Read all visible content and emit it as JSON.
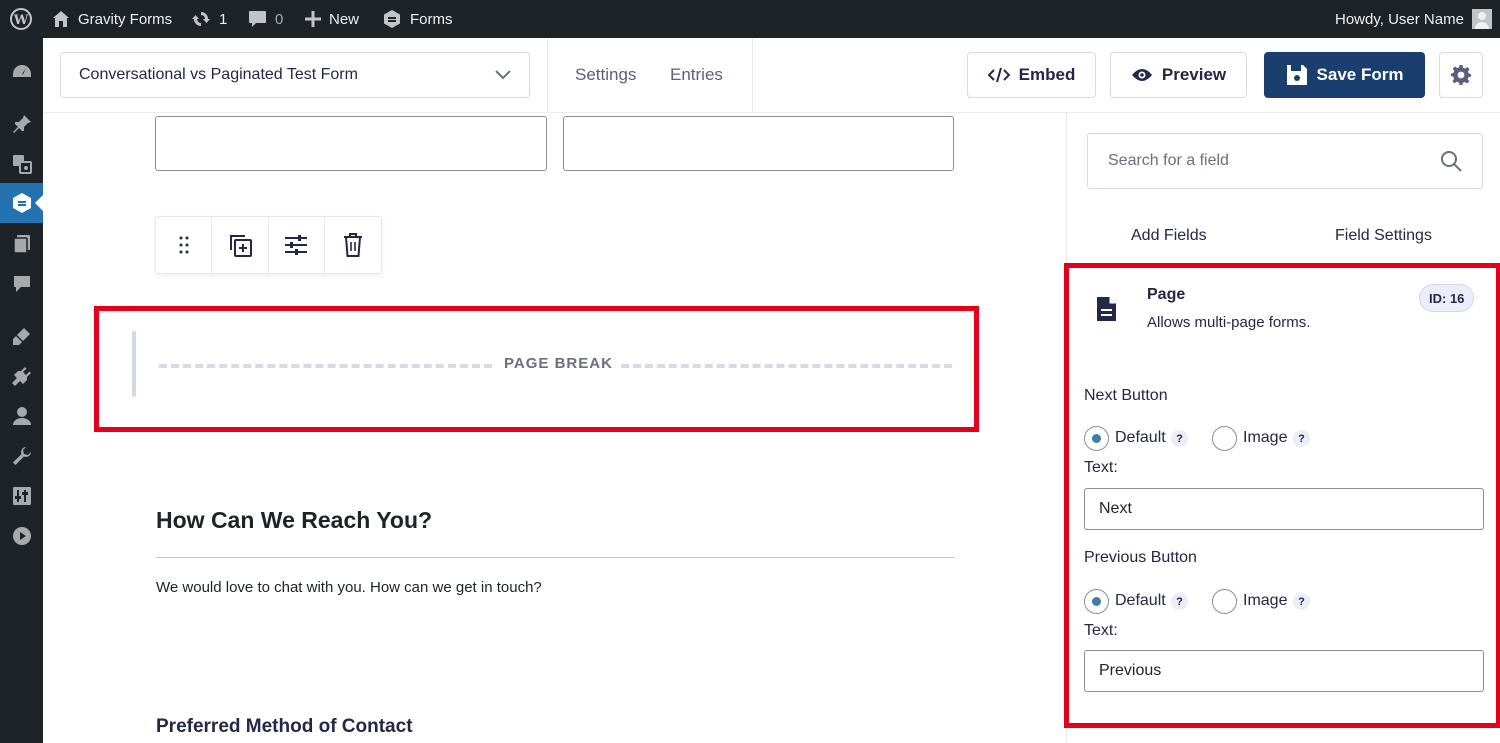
{
  "adminbar": {
    "site_name": "Gravity Forms",
    "updates_count": "1",
    "comments_count": "0",
    "new_label": "New",
    "forms_label": "Forms",
    "howdy": "Howdy, User Name"
  },
  "toolbar": {
    "form_title": "Conversational vs Paginated Test Form",
    "settings_label": "Settings",
    "entries_label": "Entries",
    "embed_label": "Embed",
    "preview_label": "Preview",
    "save_label": "Save Form"
  },
  "canvas": {
    "page_break_label": "PAGE BREAK",
    "section_title": "How Can We Reach You?",
    "section_description": "We would love to chat with you. How can we get in touch?",
    "next_field_label": "Preferred Method of Contact"
  },
  "sidebar": {
    "search_placeholder": "Search for a field",
    "tabs": [
      "Add Fields",
      "Field Settings"
    ],
    "field": {
      "name": "Page",
      "description": "Allows multi-page forms.",
      "id_badge": "ID: 16"
    },
    "next_button": {
      "label": "Next Button",
      "option_default": "Default",
      "option_image": "Image",
      "help": "?",
      "text_label": "Text:",
      "text_value": "Next",
      "selected": "Default"
    },
    "previous_button": {
      "label": "Previous Button",
      "option_default": "Default",
      "option_image": "Image",
      "help": "?",
      "text_label": "Text:",
      "text_value": "Previous",
      "selected": "Default"
    }
  },
  "colors": {
    "admin_dark": "#1d2327",
    "active_menu": "#2271b1",
    "save_button": "#1a3f6e",
    "highlight_red": "#e3001b",
    "radio_checked": "#3e7da6"
  }
}
